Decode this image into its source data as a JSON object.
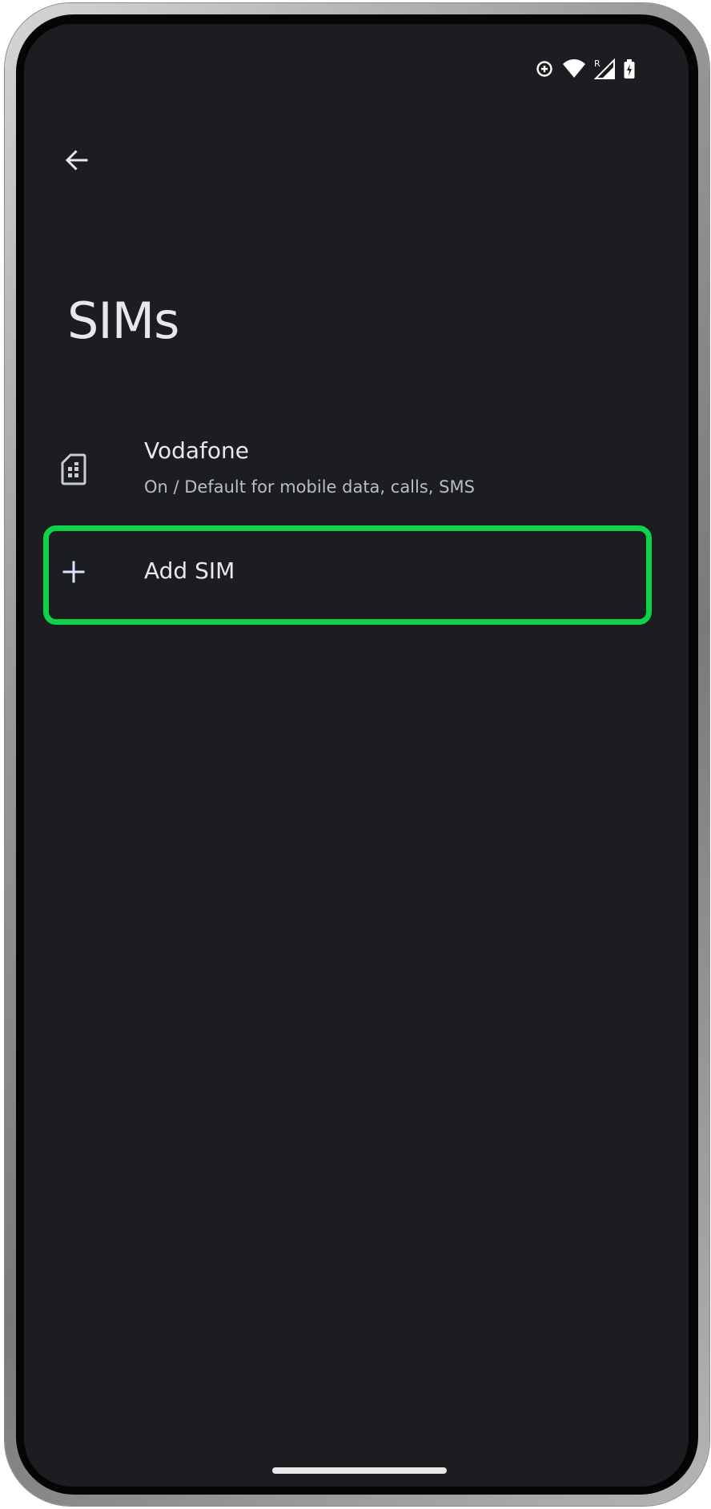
{
  "status_bar": {
    "icons": [
      "data-saver-icon",
      "wifi-icon",
      "signal-roaming-icon",
      "battery-icon"
    ],
    "roaming_indicator": "R"
  },
  "app_bar": {
    "back_icon": "arrow-back-icon"
  },
  "page": {
    "title": "SIMs"
  },
  "sims": [
    {
      "icon": "sim-card-icon",
      "name": "Vodafone",
      "summary": "On / Default for mobile data, calls, SMS"
    }
  ],
  "add_sim": {
    "icon": "plus-icon",
    "label": "Add SIM"
  },
  "colors": {
    "background": "#1b1d20",
    "primary_text": "#e6e8ec",
    "secondary_text": "#b9bdc4",
    "highlight": "#0ed24a"
  }
}
